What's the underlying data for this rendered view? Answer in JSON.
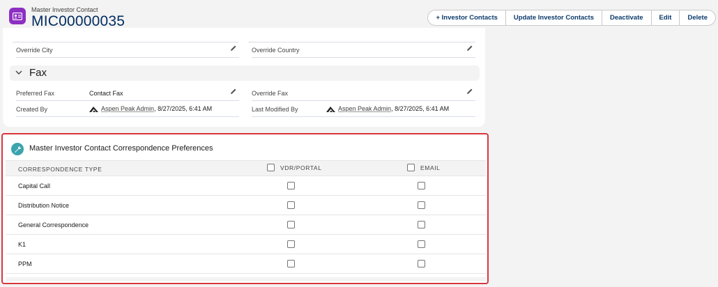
{
  "header": {
    "object_label": "Master Investor Contact",
    "record_name": "MIC00000035",
    "buttons": [
      {
        "label": "+ Investor Contacts"
      },
      {
        "label": "Update Investor Contacts"
      },
      {
        "label": "Deactivate"
      },
      {
        "label": "Edit"
      },
      {
        "label": "Delete"
      }
    ]
  },
  "details": {
    "override_city_label": "Override City",
    "override_country_label": "Override Country",
    "fax_section_title": "Fax",
    "preferred_fax_label": "Preferred Fax",
    "preferred_fax_value": "Contact Fax",
    "override_fax_label": "Override Fax",
    "created_by_label": "Created By",
    "created_by_user": "Aspen Peak Admin",
    "created_by_time": ", 8/27/2025, 6:41 AM",
    "last_modified_label": "Last Modified By",
    "last_modified_user": "Aspen Peak Admin",
    "last_modified_time": ", 8/27/2025, 6:41 AM"
  },
  "correspondence": {
    "title": "Master Investor Contact Correspondence Preferences",
    "columns": {
      "type": "Correspondence Type",
      "vdr": "VDR/Portal",
      "email": "Email"
    },
    "rows": [
      {
        "type": "Capital Call"
      },
      {
        "type": "Distribution Notice"
      },
      {
        "type": "General Correspondence"
      },
      {
        "type": "K1"
      },
      {
        "type": "PPM"
      }
    ]
  },
  "colors": {
    "record_icon": "#8d2fc2",
    "brand_text": "#032d60",
    "highlight_border": "#d9363e",
    "corr_icon": "#3ba4ae"
  }
}
